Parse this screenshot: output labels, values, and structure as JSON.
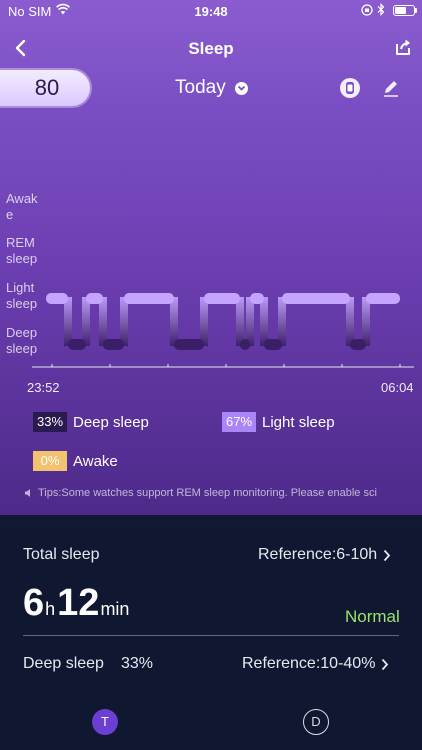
{
  "status_bar": {
    "carrier": "No SIM",
    "time": "19:48",
    "battery_level": 0.6
  },
  "nav": {
    "title": "Sleep"
  },
  "score": "80",
  "date": {
    "label": "Today"
  },
  "chart": {
    "y_labels": [
      "Awak\ne",
      "REM\nsleep",
      "Light\nsleep",
      "Deep\nsleep"
    ],
    "x_start": "23:52",
    "x_end": "06:04",
    "stage_sequence": [
      "light",
      "deep",
      "light",
      "deep",
      "light",
      "deep",
      "light",
      "deep",
      "light",
      "deep",
      "light",
      "deep",
      "light"
    ],
    "colors": {
      "light": "#c4a4ff",
      "deep": "#3a1f66",
      "awake": "#f0c26a"
    }
  },
  "legend": {
    "deep": {
      "percent": "33%",
      "label": "Deep sleep",
      "color": "#2b1a4d"
    },
    "light": {
      "percent": "67%",
      "label": "Light sleep",
      "color": "#a985f5"
    },
    "awake": {
      "percent": "0%",
      "label": "Awake",
      "color": "#f2c271"
    }
  },
  "tips": "Tips:Some watches support REM sleep monitoring. Please enable sci",
  "summary": {
    "total_label": "Total sleep",
    "total_reference": "Reference:6-10h",
    "hours": "6",
    "hours_unit": "h",
    "minutes": "12",
    "minutes_unit": "min",
    "status": "Normal",
    "deep_label": "Deep sleep",
    "deep_percent": "33%",
    "deep_reference": "Reference:10-40%"
  },
  "tabs": {
    "t": "T",
    "d": "D"
  }
}
